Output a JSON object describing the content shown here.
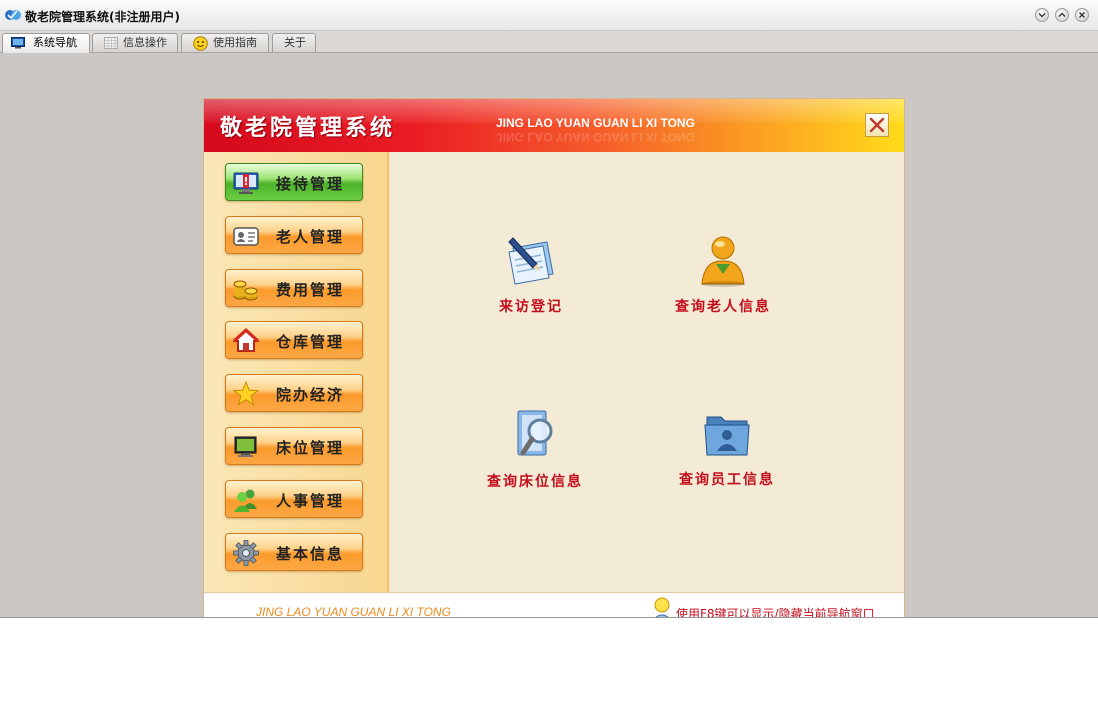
{
  "window": {
    "title": "敬老院管理系统(非注册用户)",
    "controls": [
      "collapse-icon",
      "expand-icon",
      "close-icon"
    ]
  },
  "tabs": [
    {
      "label": "系统导航",
      "icon": "monitor-icon",
      "active": true
    },
    {
      "label": "信息操作",
      "icon": "grid-icon",
      "active": false
    },
    {
      "label": "使用指南",
      "icon": "smiley-icon",
      "active": false
    },
    {
      "label": "关于",
      "icon": "",
      "active": false
    }
  ],
  "banner": {
    "title": "敬老院管理系统",
    "subtitle": "JING LAO YUAN GUAN LI XI TONG"
  },
  "sidebar": {
    "items": [
      {
        "label": "接待管理",
        "icon": "alert-monitor-icon",
        "active": true
      },
      {
        "label": "老人管理",
        "icon": "id-card-icon",
        "active": false
      },
      {
        "label": "费用管理",
        "icon": "coins-icon",
        "active": false
      },
      {
        "label": "仓库管理",
        "icon": "house-icon",
        "active": false
      },
      {
        "label": "院办经济",
        "icon": "star-icon",
        "active": false
      },
      {
        "label": "床位管理",
        "icon": "monitor-icon",
        "active": false
      },
      {
        "label": "人事管理",
        "icon": "users-icon",
        "active": false
      },
      {
        "label": "基本信息",
        "icon": "gear-icon",
        "active": false
      }
    ]
  },
  "content": {
    "items": [
      {
        "label": "来访登记",
        "icon": "notepad-pen-icon"
      },
      {
        "label": "查询老人信息",
        "icon": "person-icon"
      },
      {
        "label": "查询床位信息",
        "icon": "magnifier-document-icon"
      },
      {
        "label": "查询员工信息",
        "icon": "folder-user-icon"
      }
    ]
  },
  "footer": {
    "text": "JING LAO YUAN GUAN LI XI TONG",
    "hint": "使用F8键可以显示/隐藏当前导航窗口"
  },
  "colors": {
    "banner_start": "#d5081d",
    "banner_end": "#ffdc1a",
    "label_red": "#c40d1c",
    "button_orange": "#fb9b2c",
    "button_green": "#4cb12a"
  }
}
